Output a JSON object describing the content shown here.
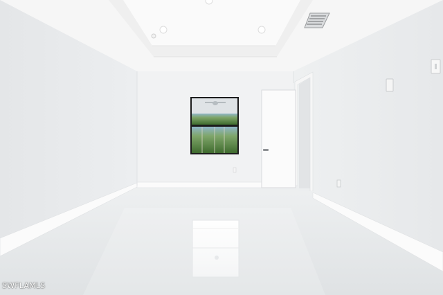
{
  "scene": {
    "subject": "empty-room-interior"
  },
  "watermark": {
    "text": "SWFLAMLS"
  },
  "palette": {
    "wall": "#f1f2f3",
    "left_wall": "#e9ebec",
    "right_wall": "#eceeef",
    "ceiling": "#f7f7f7",
    "floor": "#e6e8ea",
    "baseboard": "#fbfbfb",
    "window_frame": "#1c1c1c",
    "foliage": "#5f8f48"
  }
}
